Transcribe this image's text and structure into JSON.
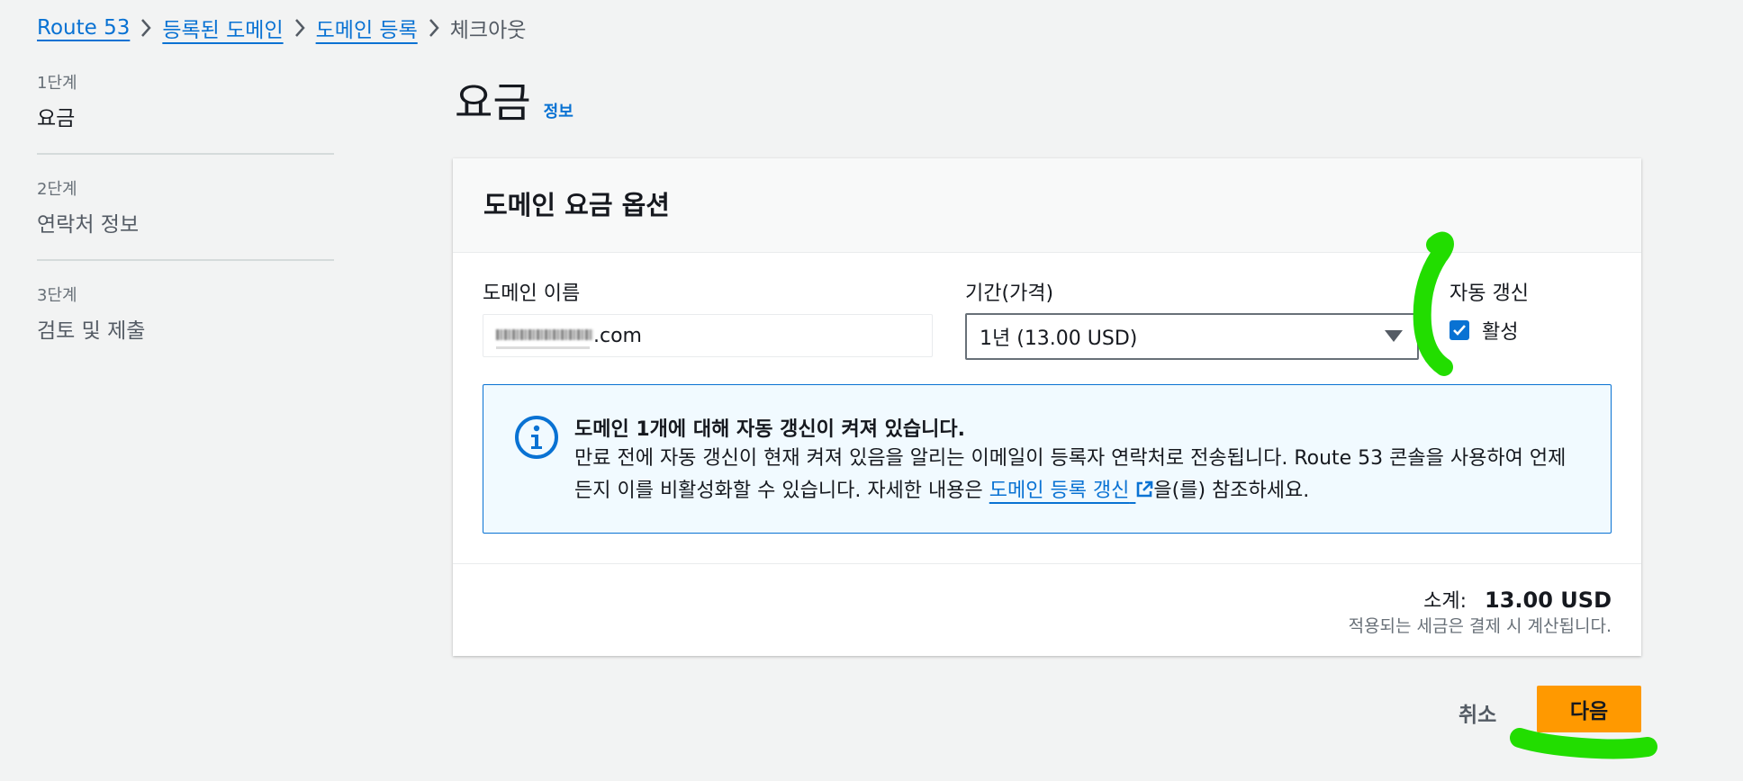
{
  "breadcrumb": [
    {
      "label": "Route 53",
      "link": true
    },
    {
      "label": "등록된 도메인",
      "link": true
    },
    {
      "label": "도메인 등록",
      "link": true
    },
    {
      "label": "체크아웃",
      "link": false
    }
  ],
  "steps": [
    {
      "number": "1단계",
      "title": "요금"
    },
    {
      "number": "2단계",
      "title": "연락처 정보"
    },
    {
      "number": "3단계",
      "title": "검토 및 제출"
    }
  ],
  "header": {
    "title": "요금",
    "info_link": "정보"
  },
  "card": {
    "title": "도메인 요금 옵션",
    "domain_name_label": "도메인 이름",
    "domain_name_suffix": ".com",
    "period_label": "기간(가격)",
    "period_value": "1년 (13.00 USD)",
    "auto_renew_label": "자동 갱신",
    "auto_renew_option": "활성",
    "auto_renew_checked": true
  },
  "alert": {
    "title": "도메인 1개에 대해 자동 갱신이 켜져 있습니다.",
    "body_1": "만료 전에 자동 갱신이 현재 켜져 있음을 알리는 이메일이 등록자 연락처로 전송됩니다. Route 53 콘솔을 사용하여 언제든지 이를 비활성화할 수 있습니다. 자세한 내용은 ",
    "link": "도메인 등록 갱신",
    "body_2": "을(를) 참조하세요."
  },
  "summary": {
    "subtotal_label": "소계:",
    "subtotal_value": "13.00 USD",
    "tax_note": "적용되는 세금은 결제 시 계산됩니다."
  },
  "footer": {
    "cancel": "취소",
    "next": "다음"
  },
  "colors": {
    "accent": "#0972d3",
    "primary_button": "#ff9900",
    "highlight_marker": "#22dd00"
  }
}
